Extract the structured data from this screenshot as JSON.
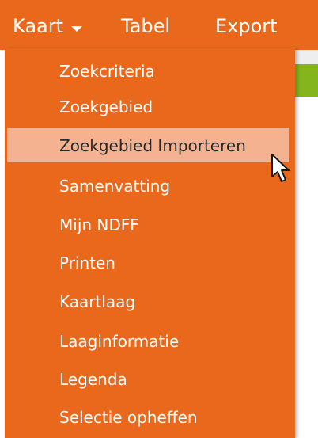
{
  "menubar": {
    "items": [
      {
        "label": "Kaart"
      },
      {
        "label": "Tabel"
      },
      {
        "label": "Export"
      }
    ]
  },
  "dropdown": {
    "items": [
      {
        "label": "Zoekcriteria"
      },
      {
        "label": "Zoekgebied"
      },
      {
        "label": "Zoekgebied Importeren"
      },
      {
        "label": "Samenvatting"
      },
      {
        "label": "Mijn NDFF"
      },
      {
        "label": "Printen"
      },
      {
        "label": "Kaartlaag"
      },
      {
        "label": "Laaginformatie"
      },
      {
        "label": "Legenda"
      },
      {
        "label": "Selectie opheffen"
      }
    ]
  },
  "icons": {
    "kaart_dropdown": "chevron-down-icon",
    "pointer": "mouse-pointer-icon"
  },
  "colors": {
    "brand_orange": "#e9681b",
    "highlight": "#f4b291",
    "green_accent": "#84b51c"
  }
}
